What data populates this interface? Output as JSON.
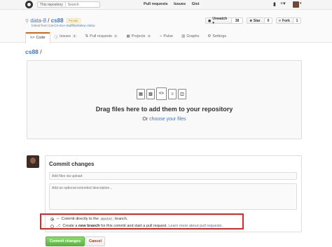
{
  "header": {
    "search_scope": "This repository",
    "search_placeholder": "Search",
    "nav": [
      "Pull requests",
      "Issues",
      "Gist"
    ],
    "plus_icon": "+▾",
    "bell_icon": "bell-icon"
  },
  "repo": {
    "owner": "data-8",
    "separator": " / ",
    "name": "cs88",
    "private_label": "Private",
    "forked_prefix": "forked from ",
    "forked_from": "Cal-CS-61A-Staff/berkeley-cs61a",
    "unwatch_label": "Unwatch ▾",
    "watch_count": "38",
    "star_label": "★ Star",
    "star_count": "0",
    "fork_label": "Fork",
    "fork_count": "1"
  },
  "tabs": [
    {
      "label": "Code",
      "icon": "<>",
      "count": ""
    },
    {
      "label": "Issues",
      "icon": "ⓘ",
      "count": "3"
    },
    {
      "label": "Pull requests",
      "icon": "⇅",
      "count": "0"
    },
    {
      "label": "Projects",
      "icon": "▦",
      "count": "0"
    },
    {
      "label": "Pulse",
      "icon": "⌁",
      "count": ""
    },
    {
      "label": "Graphs",
      "icon": "▥",
      "count": ""
    },
    {
      "label": "Settings",
      "icon": "⚙",
      "count": ""
    }
  ],
  "breadcrumb": {
    "repo": "cs88",
    "slash": " /"
  },
  "dropzone": {
    "title": "Drag files here to add them to your repository",
    "sub_prefix": "Or ",
    "sub_link": "choose your files"
  },
  "commit": {
    "title": "Commit changes",
    "summary_placeholder": "Add files via upload",
    "desc_placeholder": "Add an optional extended description...",
    "opt1_prefix": "Commit directly to the ",
    "opt1_branch": "master",
    "opt1_suffix": " branch.",
    "opt2_prefix": "Create a ",
    "opt2_bold": "new branch",
    "opt2_mid": " for this commit and start a pull request. ",
    "opt2_link": "Learn more about pull requests.",
    "commit_button": "Commit changes",
    "cancel_button": "Cancel"
  },
  "colors": {
    "accent": "#4078c0",
    "tab_active": "#d26911",
    "commit_green": "#60b044",
    "highlight_red": "#e0281f"
  }
}
